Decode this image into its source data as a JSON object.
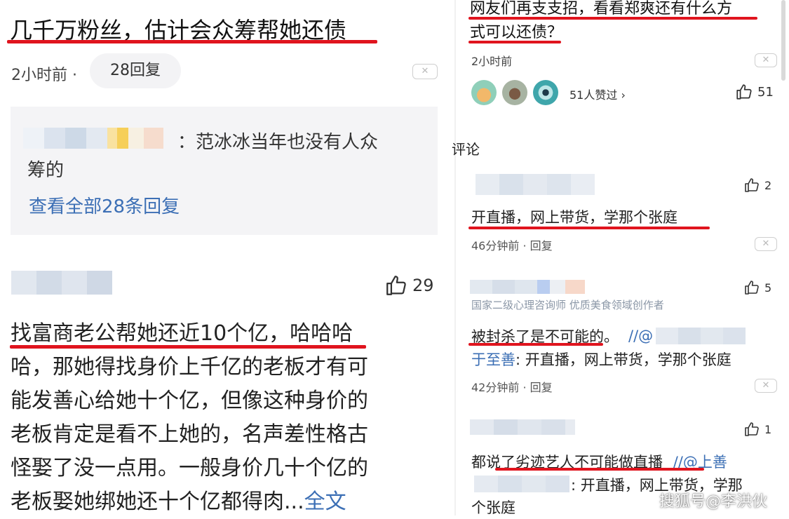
{
  "left": {
    "post": {
      "title": "几千万粉丝，估计会众筹帮她还债",
      "time": "2小时前 ·",
      "reply_count": "28回复",
      "close": "✕",
      "reply_box": {
        "text_line1": "：范冰冰当年也没有人众",
        "text_line2": "筹的",
        "view_all": "查看全部28条回复"
      }
    },
    "comment": {
      "likes": "29",
      "line1": "找富商老公帮她还近10个亿，哈哈哈",
      "line2": "哈，那她得找身价上千亿的老板才有可",
      "line3": "能发善心给她十个亿，但像这种身价的",
      "line4": "老板肯定是看不上她的，名声差性格古",
      "line5": "怪娶了没一点用。一般身价几十个亿的",
      "line6": "老板娶她绑她还十个亿都得肉...",
      "full_text": "全文"
    }
  },
  "right": {
    "post": {
      "line1": "网友们再支支招，看看郑爽还有什么方",
      "line2": "式可以还债？",
      "time": "2小时前",
      "close": "✕",
      "liked_by": "51人赞过 ›",
      "likes": "51"
    },
    "section_title": "评论",
    "comments": [
      {
        "likes": "2",
        "text": "开直播，网上带货，学那个张庭",
        "meta": "46分钟前 · 回复",
        "close": "✕"
      },
      {
        "likes": "5",
        "badge": "国家二级心理咨询师 优质美食领域创作者",
        "text": "被封杀了是不可能的。",
        "quote_prefix": "//@",
        "reply_user": "于至善",
        "reply_text": ": 开直播，网上带货，学那个张庭",
        "meta": "42分钟前 · 回复",
        "close": "✕"
      },
      {
        "likes": "1",
        "text": "都说了劣迹艺人不可能做直播",
        "quote": "//@上善",
        "reply_text_line1": ": 开直播，网上带货，学那",
        "reply_text_line2": "个张庭"
      }
    ],
    "watermark": "搜狐号@李洪伙"
  },
  "colors": {
    "underline": "#e0141e",
    "link": "#3c6fb5",
    "reply_bg": "#f4f4f6"
  }
}
